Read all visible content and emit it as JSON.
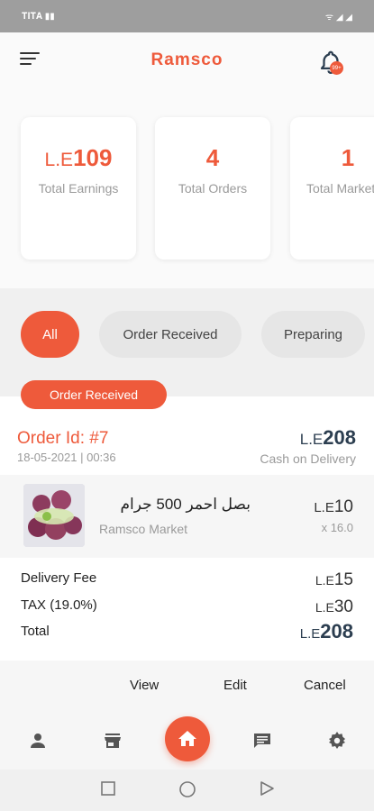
{
  "status_bar": {
    "carrier": "𝐓𝐈𝐓𝐀 ▮▮",
    "signal": "ᯤ ◢ ◢"
  },
  "header": {
    "title": "Ramsco",
    "notification_badge": "99+"
  },
  "stats": [
    {
      "currency": "L.E",
      "value": "109",
      "label": "Total Earnings"
    },
    {
      "currency": "",
      "value": "4",
      "label": "Total Orders"
    },
    {
      "currency": "",
      "value": "1",
      "label": "Total Markets"
    }
  ],
  "filters": [
    {
      "label": "All",
      "active": true
    },
    {
      "label": "Order Received",
      "active": false
    },
    {
      "label": "Preparing",
      "active": false
    }
  ],
  "order": {
    "status_badge": "Order Received",
    "id": "Order Id: #7",
    "date": "18-05-2021 | 00:36",
    "total_currency": "L.E",
    "total_value": "208",
    "payment": "Cash on Delivery",
    "product": {
      "name": "بصل احمر 500 جرام",
      "store": "Ramsco Market",
      "price_currency": "L.E",
      "price_value": "10",
      "quantity": "x 16.0"
    },
    "fees": [
      {
        "label": "Delivery Fee",
        "currency": "L.E",
        "value": "15"
      },
      {
        "label": "TAX (19.0%)",
        "currency": "L.E",
        "value": "30"
      },
      {
        "label": "Total",
        "currency": "L.E",
        "value": "208"
      }
    ],
    "actions": {
      "view": "View",
      "edit": "Edit",
      "cancel": "Cancel"
    }
  },
  "colors": {
    "accent": "#ee5a3b",
    "dark_text": "#2c3e50"
  },
  "bottom_nav": [
    "profile-icon",
    "store-icon",
    "home-icon",
    "chat-icon",
    "settings-icon"
  ]
}
